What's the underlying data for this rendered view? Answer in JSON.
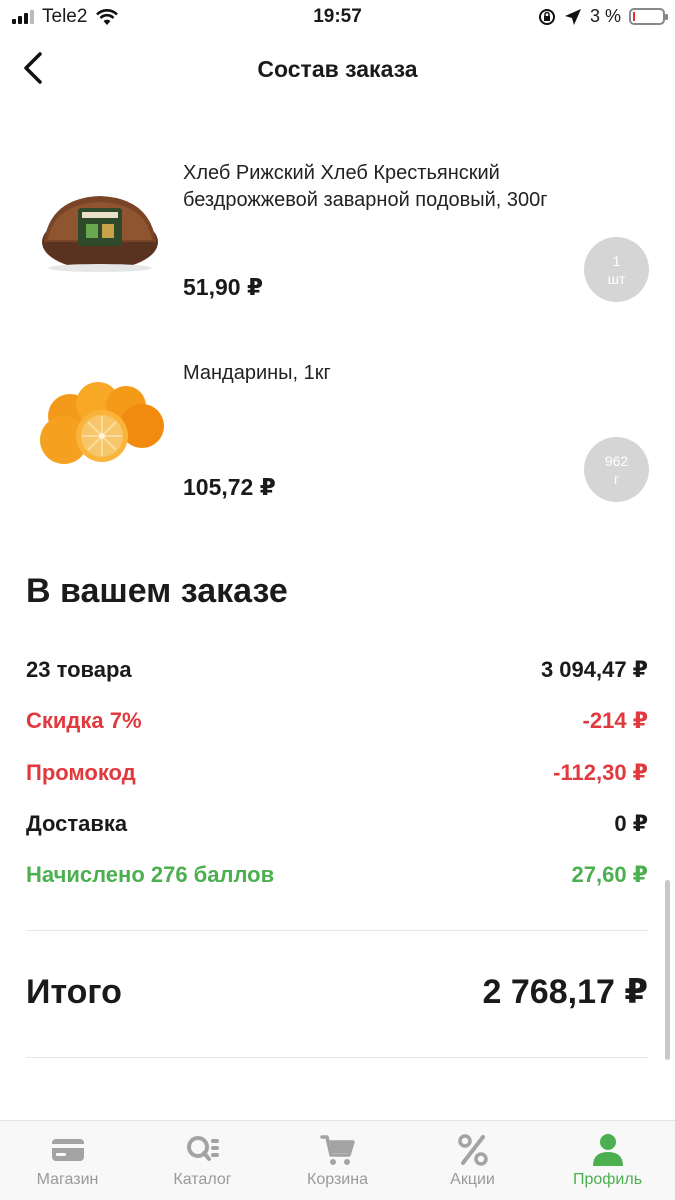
{
  "status_bar": {
    "carrier": "Tele2",
    "time": "19:57",
    "battery_text": "3 %"
  },
  "header": {
    "title": "Состав заказа"
  },
  "products": [
    {
      "name": "Хлеб Рижский Хлеб Крестьянский бездрожжевой заварной подовый, 300г",
      "price": "51,90 ₽",
      "qty_value": "1",
      "qty_unit": "шт",
      "image_icon": "bread-image"
    },
    {
      "name": "Мандарины, 1кг",
      "price": "105,72 ₽",
      "qty_value": "962",
      "qty_unit": "г",
      "image_icon": "mandarins-image"
    }
  ],
  "summary": {
    "title": "В вашем заказе",
    "rows": [
      {
        "label": "23 товара",
        "value": "3 094,47 ₽"
      },
      {
        "label": "Скидка 7%",
        "value": "-214 ₽"
      },
      {
        "label": "Промокод",
        "value": "-112,30 ₽"
      },
      {
        "label": "Доставка",
        "value": "0 ₽"
      },
      {
        "label": "Начислено 276 баллов",
        "value": "27,60 ₽"
      }
    ],
    "total_label": "Итого",
    "total_value": "2 768,17 ₽"
  },
  "tabs": [
    {
      "label": "Магазин",
      "icon": "card-icon"
    },
    {
      "label": "Каталог",
      "icon": "catalog-search-icon"
    },
    {
      "label": "Корзина",
      "icon": "cart-icon"
    },
    {
      "label": "Акции",
      "icon": "percent-icon"
    },
    {
      "label": "Профиль",
      "icon": "profile-icon",
      "active": true
    }
  ],
  "colors": {
    "accent_green": "#4caf50",
    "discount_red": "#e0393e",
    "qty_badge": "#d5d5d5"
  }
}
